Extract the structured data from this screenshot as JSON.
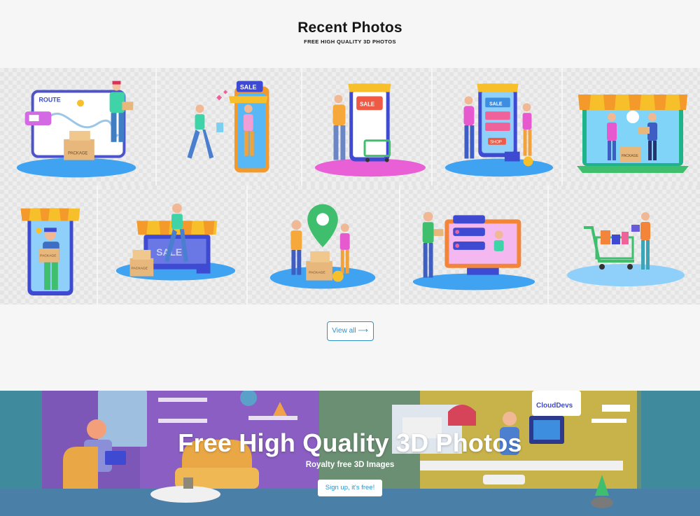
{
  "section": {
    "title": "Recent Photos",
    "subtitle": "FREE HIGH QUALITY 3D PHOTOS"
  },
  "gallery": {
    "row1": [
      {
        "icon": "delivery-route-illustration",
        "route_label": "ROUTE",
        "package_label": "PACKAGE"
      },
      {
        "icon": "phone-sale-shopping-illustration",
        "sale_label": "SALE"
      },
      {
        "icon": "online-store-cart-illustration",
        "sale_label": "SALE"
      },
      {
        "icon": "mobile-shop-illustration",
        "sale_label": "SALE",
        "shop_label": "SHOP"
      },
      {
        "icon": "laptop-store-delivery-illustration",
        "package_label": "PACKAGE"
      }
    ],
    "row2": [
      {
        "icon": "phone-courier-illustration",
        "package_label": "PACKAGE"
      },
      {
        "icon": "storefront-sale-illustration",
        "sale_label": "SALE",
        "package_label": "PACKAGE"
      },
      {
        "icon": "location-pin-delivery-illustration",
        "package_label": "PACKAGE"
      },
      {
        "icon": "monitor-online-order-illustration"
      },
      {
        "icon": "shopping-cart-gift-illustration"
      }
    ]
  },
  "view_all": {
    "label": "View all ⟶"
  },
  "banner": {
    "title": "Free High Quality 3D Photos",
    "subtitle": "Royalty free 3D Images",
    "cta": "Sign up, it's free!",
    "sign_text": "CloudDevs"
  },
  "colors": {
    "accent": "#2c93c8",
    "banner_bg": "#43899b",
    "platform_blue": "#3fa3f2",
    "platform_pink": "#e85fd6",
    "awning_yellow": "#f7c02b",
    "awning_orange": "#f39a2a"
  }
}
